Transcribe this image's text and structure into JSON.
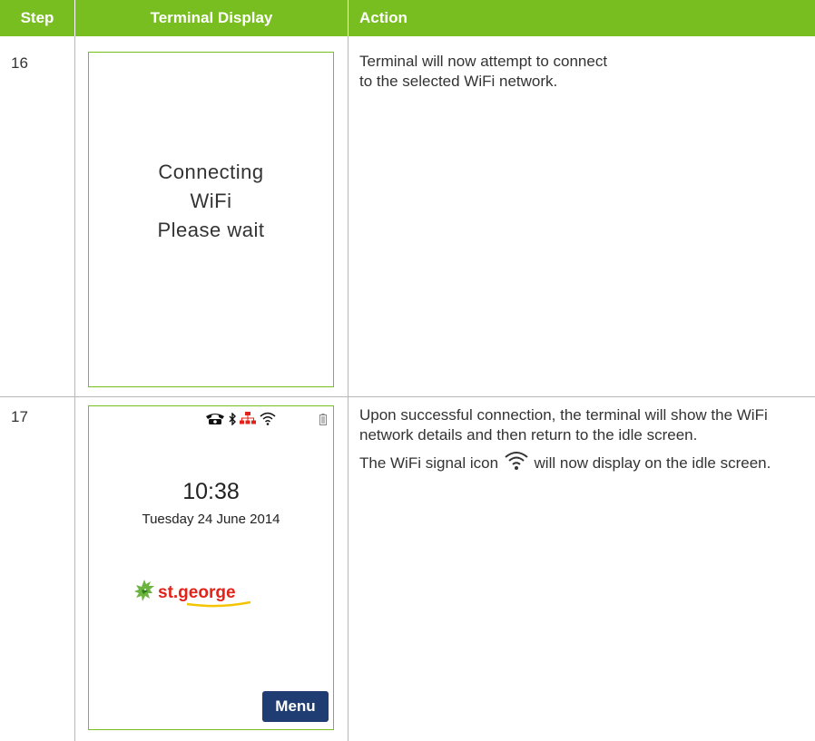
{
  "header": {
    "step": "Step",
    "display": "Terminal Display",
    "action": "Action"
  },
  "rows": [
    {
      "step": "16",
      "screen": {
        "line1": "Connecting",
        "line2": "WiFi",
        "line3": "Please wait"
      },
      "action": {
        "line1": "Terminal will now attempt to connect",
        "line2": "to the selected WiFi network."
      }
    },
    {
      "step": "17",
      "screen": {
        "time": "10:38",
        "date": "Tuesday 24 June 2014",
        "brand": "st.george",
        "menu": "Menu",
        "status_icons": [
          "phone-icon",
          "bluetooth-icon",
          "network-icon",
          "wifi-icon",
          "battery-icon"
        ]
      },
      "action": {
        "p1": "Upon successful connection, the terminal will show the WiFi network details and then return to the idle screen.",
        "p2_before": "The WiFi signal icon",
        "p2_after": "will now display on the idle screen."
      }
    }
  ],
  "colors": {
    "header_bg": "#78be20",
    "border": "#78be20",
    "menu_bg": "#1f3d73",
    "brand_red": "#e2231a"
  }
}
